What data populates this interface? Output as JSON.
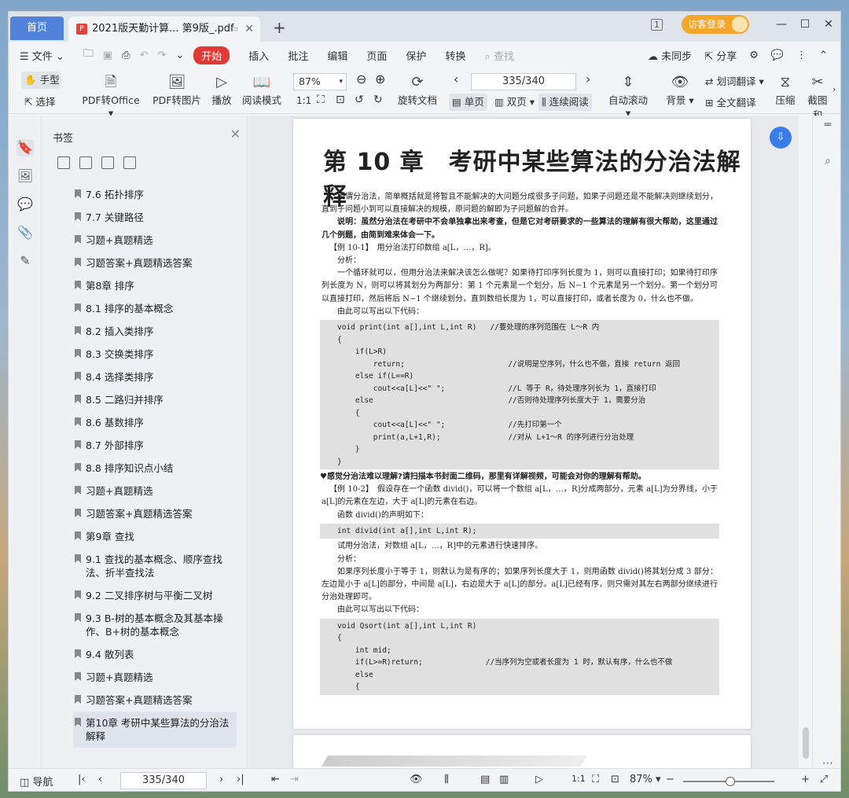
{
  "tabs": {
    "home": "首页",
    "document": "2021版天勤计算... 第9版_.pdf"
  },
  "window": {
    "visitor_login": "访客登录",
    "badge": "1"
  },
  "menu": {
    "file": "文件",
    "start": "开始",
    "insert": "插入",
    "annotate": "批注",
    "edit": "编辑",
    "page": "页面",
    "protect": "保护",
    "convert": "转换",
    "search": "查找",
    "unsynced": "未同步",
    "share": "分享"
  },
  "ribbon": {
    "hand": "手型",
    "select": "选择",
    "pdf_to_office": "PDF转Office",
    "pdf_to_image": "PDF转图片",
    "play": "播放",
    "read_mode": "阅读模式",
    "zoom": "87%",
    "rotate_doc": "旋转文档",
    "page_indicator": "335/340",
    "single_page": "单页",
    "double_page": "双页",
    "continuous": "连续阅读",
    "auto_scroll": "自动滚动",
    "background": "背景",
    "word_translate": "划词翻译",
    "full_translate": "全文翻译",
    "compress": "压缩",
    "screenshot": "截图和"
  },
  "sidebar": {
    "title": "书签",
    "bookmarks": [
      "7.6 拓扑排序",
      "7.7 关键路径",
      "习题+真题精选",
      "习题答案+真题精选答案",
      "第8章  排序",
      "8.1 排序的基本概念",
      "8.2 插入类排序",
      "8.3 交换类排序",
      "8.4 选择类排序",
      "8.5 二路归并排序",
      "8.6 基数排序",
      "8.7 外部排序",
      "8.8 排序知识点小结",
      "习题+真题精选",
      "习题答案+真题精选答案",
      "第9章  查找",
      "9.1 查找的基本概念、顺序查找法、折半查找法",
      "9.2 二叉排序树与平衡二叉树",
      "9.3 B-树的基本概念及其基本操作、B+树的基本概念",
      "9.4 散列表",
      "习题+真题精选",
      "习题答案+真题精选答案",
      "第10章  考研中某些算法的分治法解释"
    ]
  },
  "document": {
    "chapter_title": "第 10 章　考研中某些算法的分治法解释",
    "p1": "所谓分治法，简单概括就是将暂且不能解决的大问题分成很多子问题，如果子问题还是不能解决则继续划分，直到子问题小到可以直接解决的规模，原问题的解即为子问题解的合并。",
    "p2": "说明：虽然分治法在考研中不会单独拿出来考查，但是它对考研要求的一些算法的理解有很大帮助，这里通过几个例题，由简到难来体会一下。",
    "ex1": "【例 10-1】　用分治法打印数组 a[L，…，R]。",
    "analysis1": "分析：",
    "p3": "一个循环就可以，但用分治法来解决该怎么做呢？如果待打印序列长度为 1，则可以直接打印；如果待打印序列长度为 N，则可以将其划分为两部分：第 1 个元素是一个划分，后 N−1 个元素是另一个划分。第一个划分可以直接打印，然后将后 N−1 个继续划分，直到数组长度为 1，可以直接打印，或者长度为 0，什么也不做。",
    "code_intro1": "由此可以写出以下代码：",
    "code1": "void print(int a[],int L,int R)   //要处理的序列范围在 L～R 内\n{\n    if(L>R)\n        return;                       //说明是空序列，什么也不做，直接 return 返回\n    else if(L==R)\n        cout<<a[L]<<\" \";              //L 等于 R，待处理序列长为 1，直接打印\n    else                              //否则待处理序列长度大于 1，需要分治\n    {\n        cout<<a[L]<<\" \";              //先打印第一个\n        print(a,L+1,R);               //对从 L+1～R 的序列进行分治处理\n    }\n}",
    "alert": "♥感觉分治法难以理解?请扫描本书封面二维码，那里有详解视频，可能会对你的理解有帮助。",
    "ex2": "【例 10-2】　假设存在一个函数 divid()，可以将一个数组 a[L，…，R]分成两部分，元素 a[L]为分界线，小于 a[L]的元素在左边，大于 a[L]的元素在右边。",
    "divid_decl_intro": "函数 divid()的声明如下：",
    "code2": "int divid(int a[],int L,int R);",
    "ex2_task": "试用分治法，对数组 a[L，…，R]中的元素进行快速排序。",
    "analysis2": "分析：",
    "p4": "如果序列长度小于等于 1，则默认为是有序的；如果序列长度大于 1，则用函数 divid()将其划分成 3 部分：左边是小于 a[L]的部分，中间是 a[L]，右边是大于 a[L]的部分。a[L]已经有序，则只需对其左右两部分继续进行分治处理即可。",
    "code_intro2": "由此可以写出以下代码：",
    "code3": "void Qsort(int a[],int L,int R)\n{\n    int mid;\n    if(L>=R)return;              //当序列为空或者长度为 1 时，默认有序，什么也不做\n    else\n    {"
  },
  "statusbar": {
    "nav": "导航",
    "page": "335/340",
    "zoom": "87%"
  }
}
